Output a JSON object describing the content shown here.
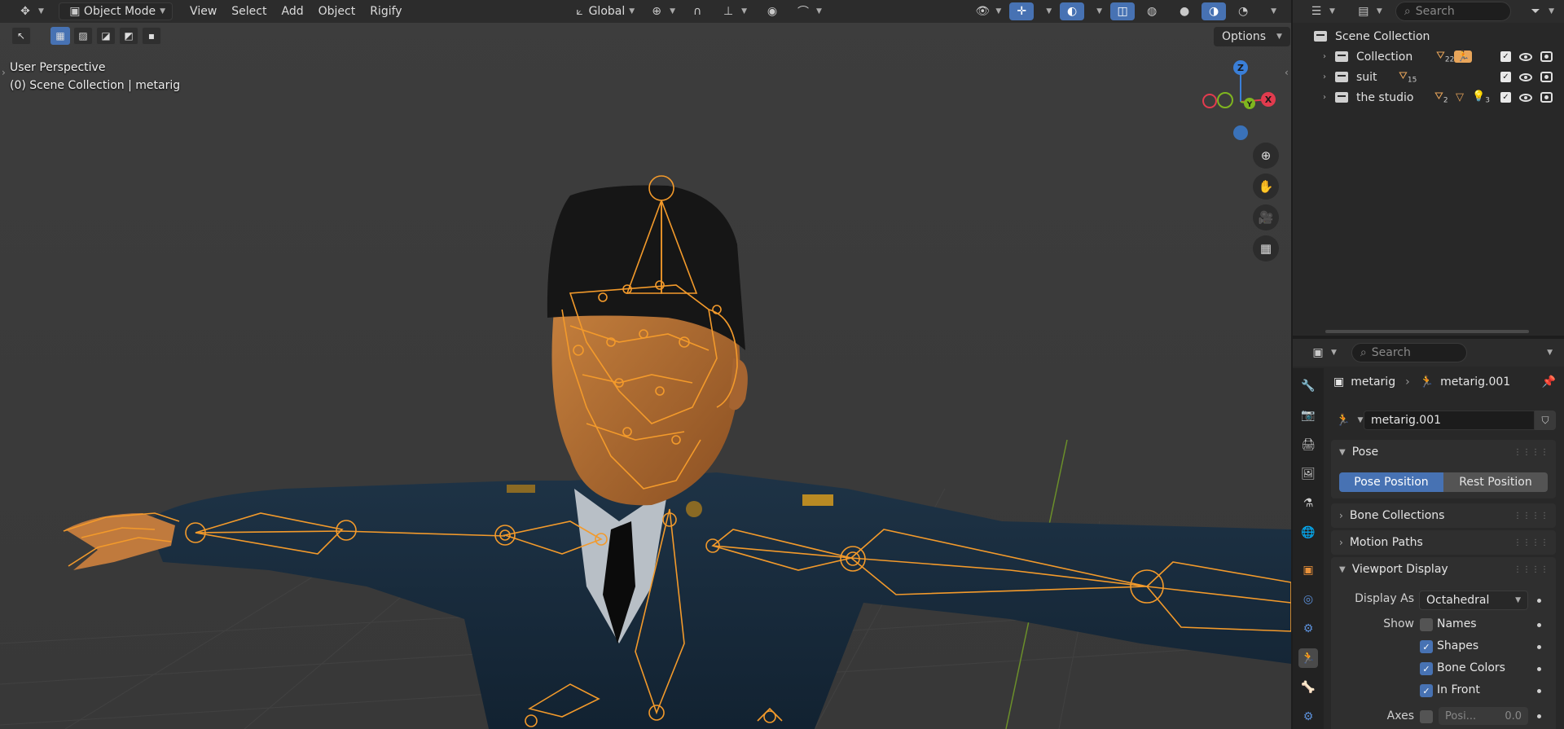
{
  "header": {
    "editor_icon": "view3d-icon",
    "mode": "Object Mode",
    "menus": [
      "View",
      "Select",
      "Add",
      "Object",
      "Rigify"
    ],
    "transform_orientation": "Global",
    "options_label": "Options"
  },
  "viewport": {
    "perspective_label": "User Perspective",
    "collection_label": "(0) Scene Collection | metarig",
    "gizmo": {
      "x": "X",
      "y": "Y",
      "z": "Z"
    }
  },
  "outliner": {
    "search_placeholder": "Search",
    "root": "Scene Collection",
    "items": [
      {
        "label": "Collection",
        "badge": "22"
      },
      {
        "label": "suit",
        "badge": "15"
      },
      {
        "label": "the studio",
        "badge": "2",
        "badge2": "3"
      }
    ]
  },
  "properties": {
    "search_placeholder": "Search",
    "breadcrumb_object": "metarig",
    "breadcrumb_data": "metarig.001",
    "data_name": "metarig.001",
    "pose": {
      "title": "Pose",
      "pose_position": "Pose Position",
      "rest_position": "Rest Position"
    },
    "bone_collections": "Bone Collections",
    "motion_paths": "Motion Paths",
    "viewport_display": {
      "title": "Viewport Display",
      "display_as_label": "Display As",
      "display_as_value": "Octahedral",
      "show_label": "Show",
      "names": "Names",
      "shapes": "Shapes",
      "bone_colors": "Bone Colors",
      "in_front": "In Front",
      "axes_label": "Axes",
      "axes_position": "Posi...",
      "axes_value": "0.0"
    }
  },
  "colors": {
    "accent": "#4772b3",
    "bone": "#f39a2b",
    "x_axis": "#e23b4e",
    "y_axis": "#7fb51f",
    "z_axis": "#3a7fd8"
  }
}
